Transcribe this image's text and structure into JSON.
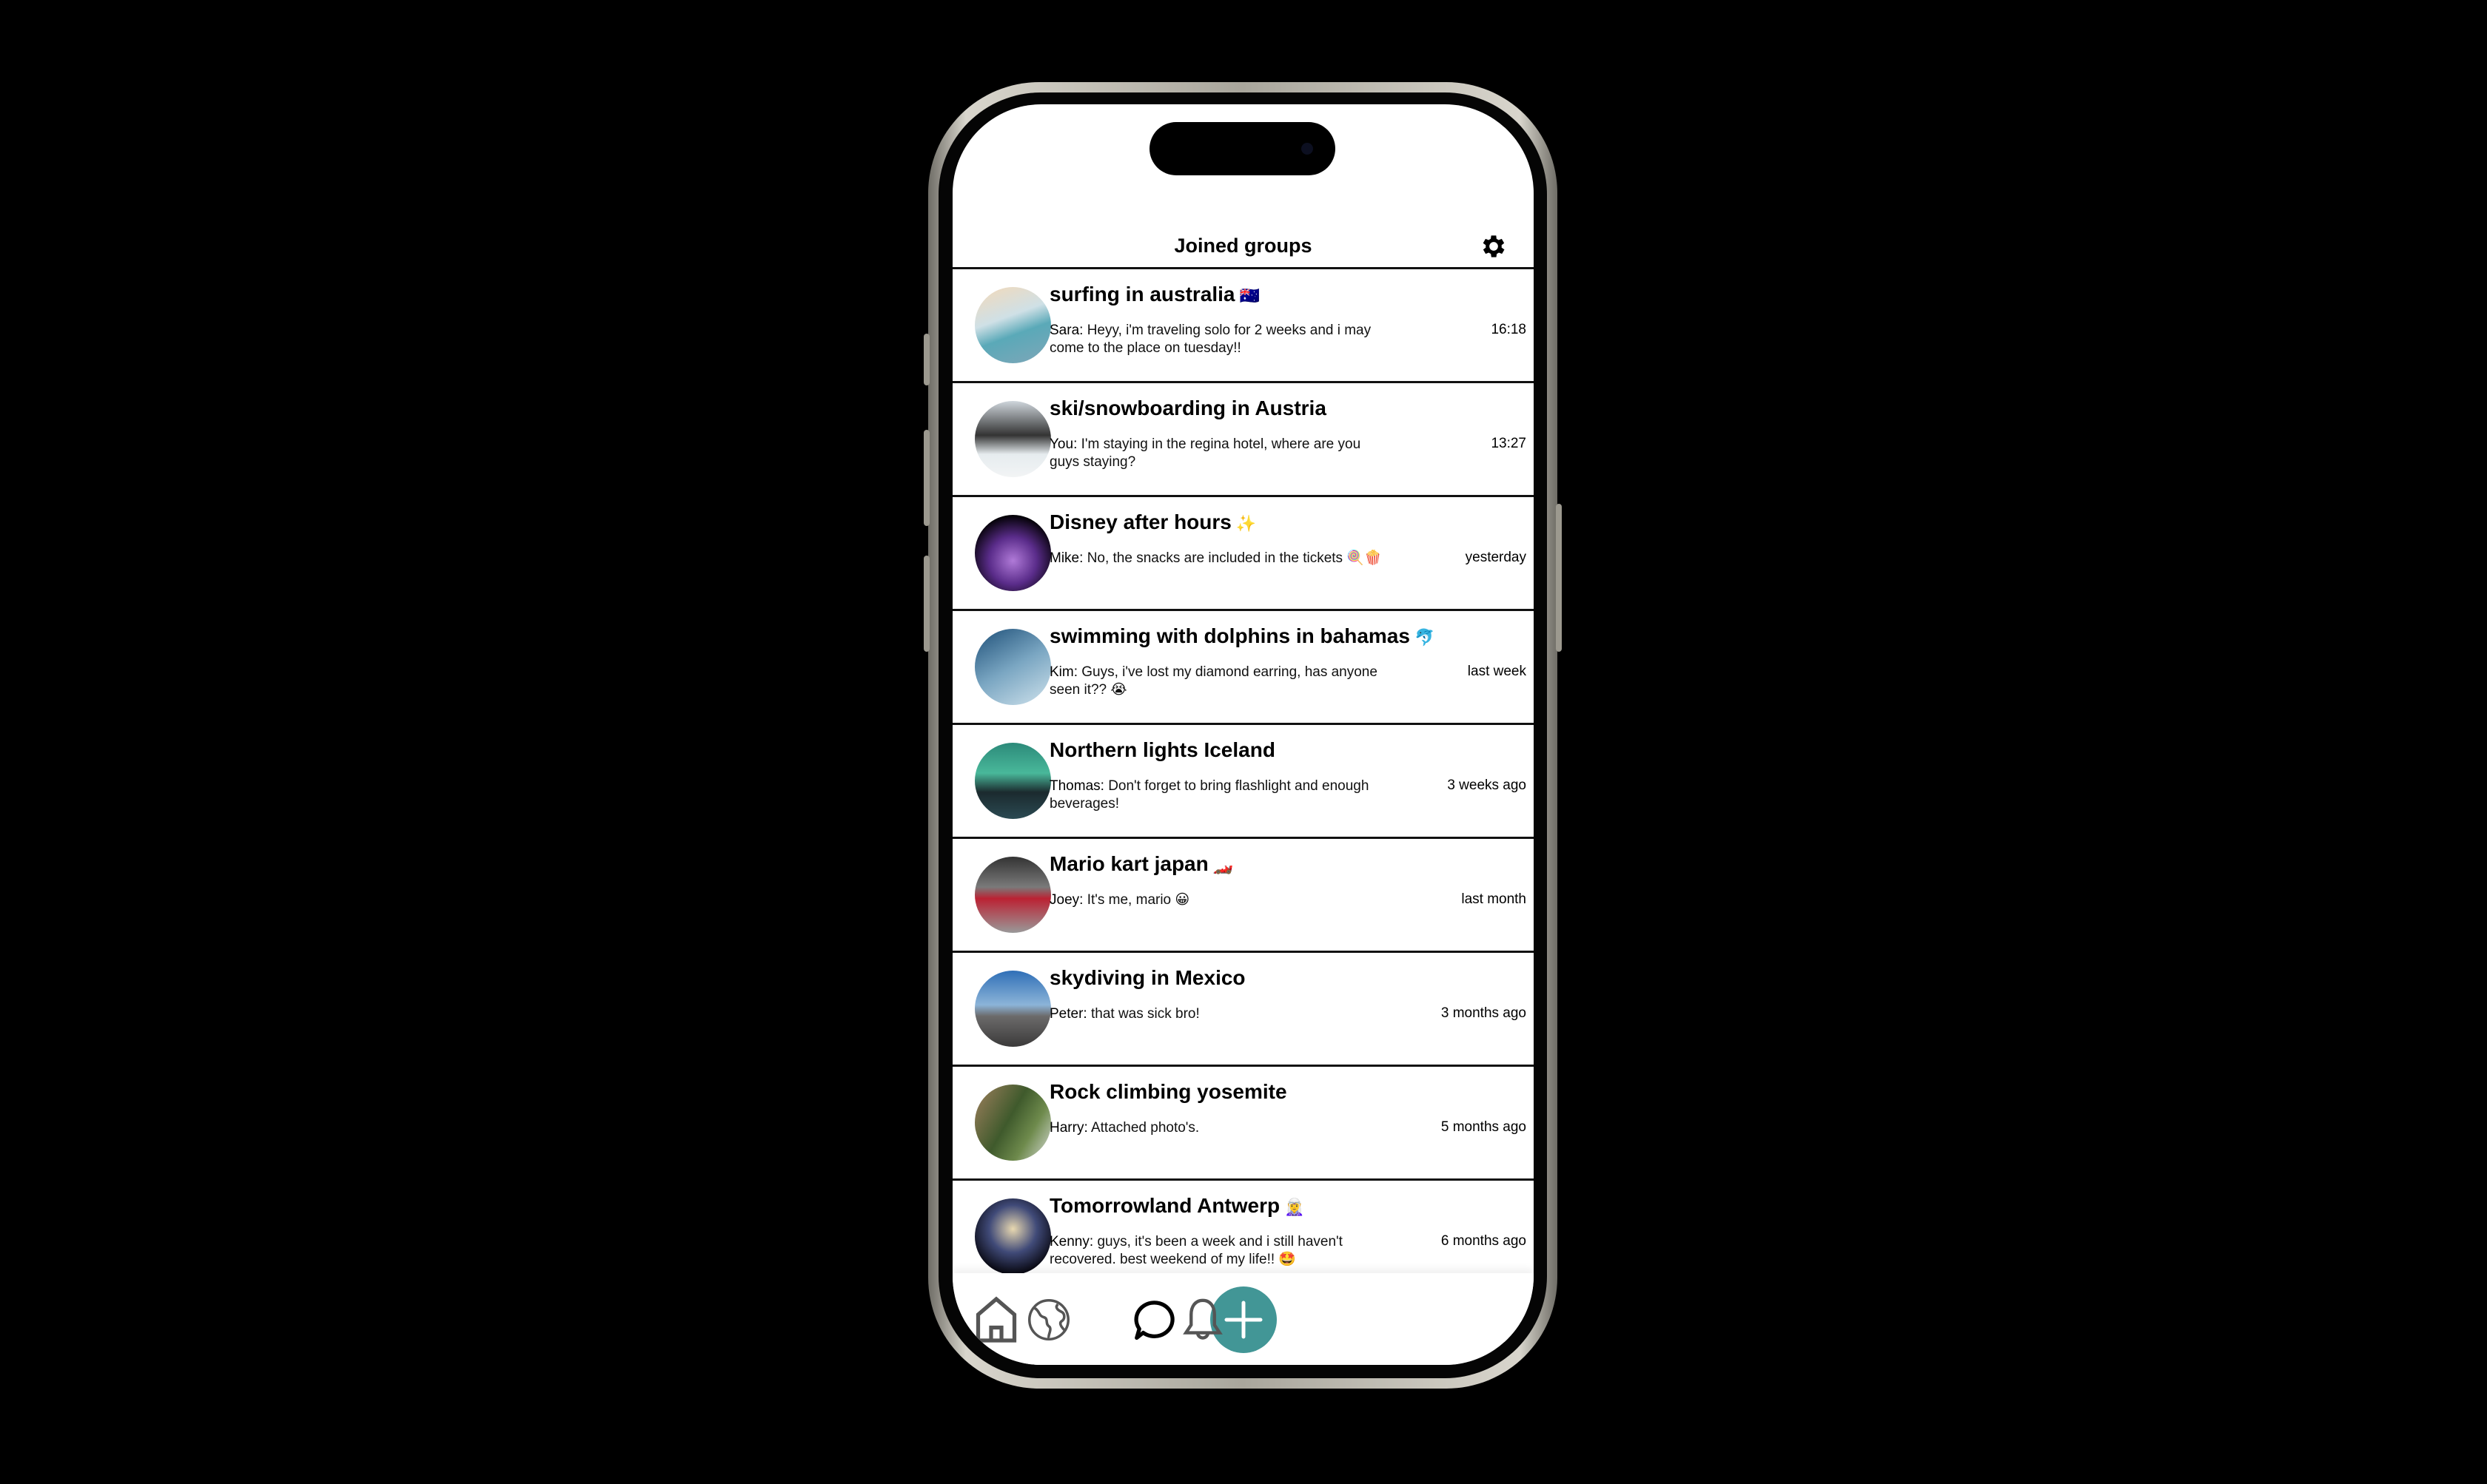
{
  "header": {
    "title": "Joined groups",
    "settings_icon": "gear-icon"
  },
  "groups": [
    {
      "name": "surfing in australia",
      "emoji": "🇦🇺",
      "sender": "Sara:",
      "message": "Heyy, i'm traveling solo for 2 weeks and i may come to the place on tuesday!!",
      "time": "16:18"
    },
    {
      "name": "ski/snowboarding in Austria",
      "emoji": "",
      "sender": "You:",
      "message": "I'm staying in the regina hotel, where are you guys staying?",
      "time": "13:27"
    },
    {
      "name": "Disney after hours",
      "emoji": "✨",
      "sender": "Mike:",
      "message": "No, the snacks are included in the tickets 🍭🍿",
      "time": "yesterday"
    },
    {
      "name": "swimming with dolphins in bahamas",
      "emoji": "🐬",
      "sender": "Kim:",
      "message": "Guys, i've lost my diamond earring, has anyone seen it?? 😭",
      "time": "last week"
    },
    {
      "name": "Northern lights Iceland",
      "emoji": "",
      "sender": "Thomas:",
      "message": "Don't forget to bring flashlight and enough beverages!",
      "time": "3 weeks ago"
    },
    {
      "name": "Mario kart japan",
      "emoji": "🏎️",
      "sender": "Joey:",
      "message": "It's me, mario 😀",
      "time": "last month"
    },
    {
      "name": "skydiving in Mexico",
      "emoji": "",
      "sender": "Peter:",
      "message": "that was sick bro!",
      "time": "3 months ago"
    },
    {
      "name": "Rock climbing yosemite",
      "emoji": "",
      "sender": "Harry:",
      "message": "Attached photo's.",
      "time": "5 months ago"
    },
    {
      "name": "Tomorrowland Antwerp",
      "emoji": "🧝‍♀️",
      "sender": "Kenny:",
      "message": "guys, it's been a week and i still haven't recovered. best weekend of my life!! 🤩",
      "time": "6 months ago"
    }
  ],
  "nav": {
    "items": [
      "home-icon",
      "globe-icon",
      "plus-icon",
      "chat-bubble-icon",
      "bell-icon"
    ],
    "accent": "#429696"
  }
}
